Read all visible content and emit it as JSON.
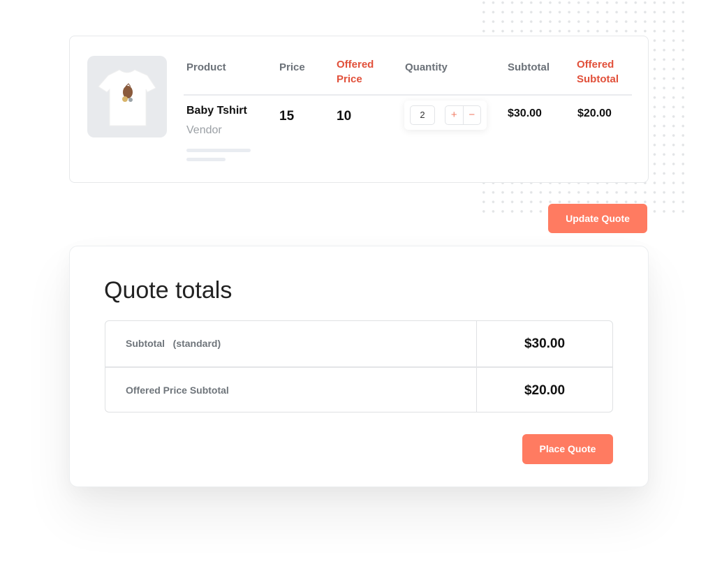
{
  "cart": {
    "columns": {
      "product": "Product",
      "price": "Price",
      "offered_price_1": "Offered",
      "offered_price_2": "Price",
      "quantity": "Quantity",
      "subtotal": "Subtotal",
      "offered_subtotal_1": "Offered",
      "offered_subtotal_2": "Subtotal"
    },
    "item": {
      "image": "baby-tshirt-image",
      "name": "Baby Tshirt",
      "vendor": "Vendor",
      "price": "15",
      "offered_price": "10",
      "quantity": "2",
      "increment_symbol": "+",
      "decrement_symbol": "−",
      "subtotal": "$30.00",
      "offered_subtotal": "$20.00"
    },
    "update_button": "Update Quote"
  },
  "totals": {
    "title": "Quote totals",
    "rows": [
      {
        "label": "Subtotal   (standard)",
        "value": "$30.00"
      },
      {
        "label": "Offered Price Subtotal",
        "value": "$20.00"
      }
    ],
    "place_button": "Place Quote"
  },
  "colors": {
    "accent": "#ff7b61",
    "offered_header": "#e1503a",
    "header_gray": "#6b7178"
  }
}
